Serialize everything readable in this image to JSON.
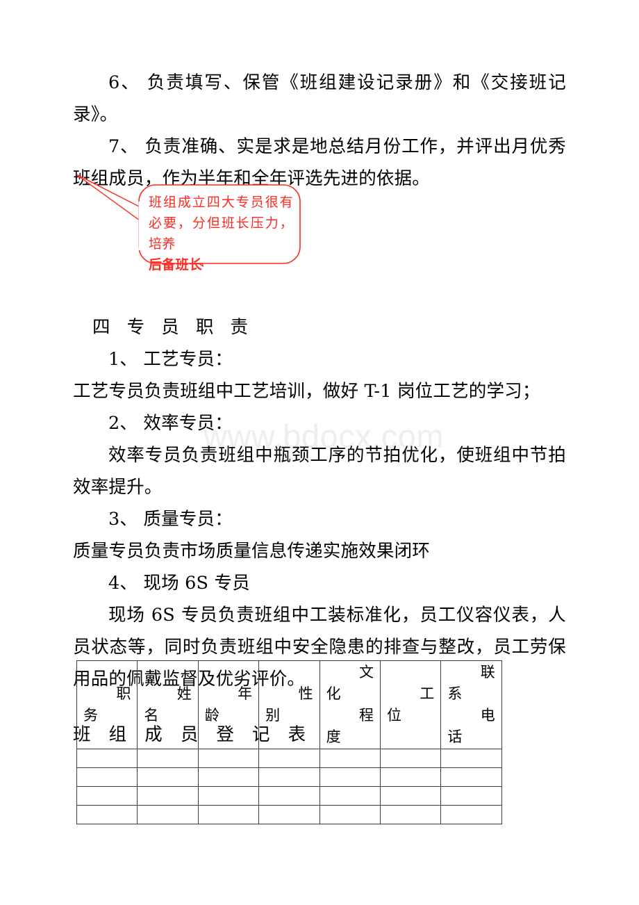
{
  "document": {
    "watermark": "www.bdocx.com",
    "paragraphs": [
      {
        "id": "item6",
        "text": "6、 负责填写、保管《班组建设记录册》和《交接班记录》。"
      },
      {
        "id": "item7",
        "text": "7、 负责准确、实是求是地总结月份工作，并评出月优秀班组成员，作为半年和全年评选先进的依据。"
      }
    ],
    "section_heading": "四 专 员 职 责",
    "sections": [
      {
        "id": "s1_title",
        "text": "1、 工艺专员："
      },
      {
        "id": "s1_body",
        "text": "工艺专员负责班组中工艺培训，做好 T-1 岗位工艺的学习；"
      },
      {
        "id": "s2_title",
        "text": "2、 效率专员："
      },
      {
        "id": "s2_body",
        "text": "效率专员负责班组中瓶颈工序的节拍优化，使班组中节拍效率提升。"
      },
      {
        "id": "s3_title",
        "text": "3、 质量专员："
      },
      {
        "id": "s3_body",
        "text": "质量专员负责市场质量信息传递实施效果闭环"
      },
      {
        "id": "s4_title",
        "text": "4、 现场 6S 专员"
      },
      {
        "id": "s4_body",
        "text": "现场 6S 专员负责班组中工装标准化，员工仪容仪表，人员状态等，同时负责班组中安全隐患的排查与整改，员工劳保用品的佩戴监督及优劣评价。"
      }
    ],
    "callout": {
      "color": "#ff2a20",
      "line1": "班组成立四大专员很有必",
      "line2": "要，分但班长压力，培养",
      "line3": "后备班长"
    },
    "table": {
      "title": "班 组 成 员 登 记 表",
      "columns": [
        {
          "label": "职务",
          "top": "职",
          "bottom": "务"
        },
        {
          "label": "姓名",
          "top": "姓",
          "bottom": "名"
        },
        {
          "label": "年龄",
          "top": "年",
          "bottom": "龄"
        },
        {
          "label": "性别",
          "top": "性",
          "bottom": "别"
        },
        {
          "label": "文化程度",
          "c1": "文",
          "c2": "化",
          "c3": "程",
          "c4": "度"
        },
        {
          "label": "工位",
          "top": "工",
          "bottom": "位"
        },
        {
          "label": "联系电话",
          "c1": "联",
          "c2": "系",
          "c3": "电",
          "c4": "话"
        }
      ],
      "empty_row_count": 4
    }
  }
}
